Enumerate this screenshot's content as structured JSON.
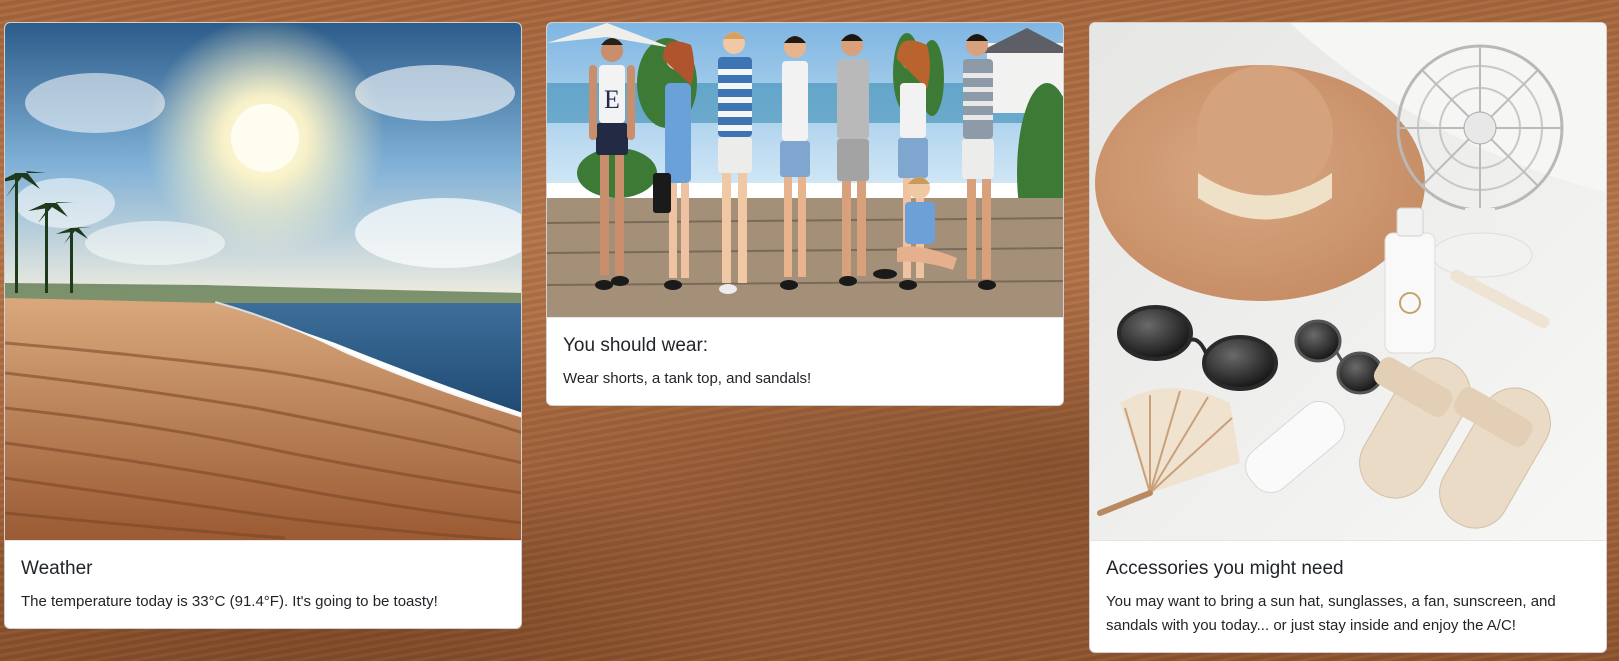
{
  "cards": [
    {
      "title": "Weather",
      "text": "The temperature today is 33°C (91.4°F). It's going to be toasty!",
      "image": "sunny-beach-illustration"
    },
    {
      "title": "You should wear:",
      "text": "Wear shorts, a tank top, and sandals!",
      "image": "summer-outfits-illustration",
      "shirt_letter": "E"
    },
    {
      "title": "Accessories you might need",
      "text": "You may want to bring a sun hat, sunglasses, a fan, sunscreen, and sandals with you today... or just stay inside and enjoy the A/C!",
      "image": "summer-accessories-illustration"
    }
  ],
  "colors": {
    "background_sand": "#a9683f",
    "card_bg": "#ffffff",
    "text": "#212529"
  }
}
